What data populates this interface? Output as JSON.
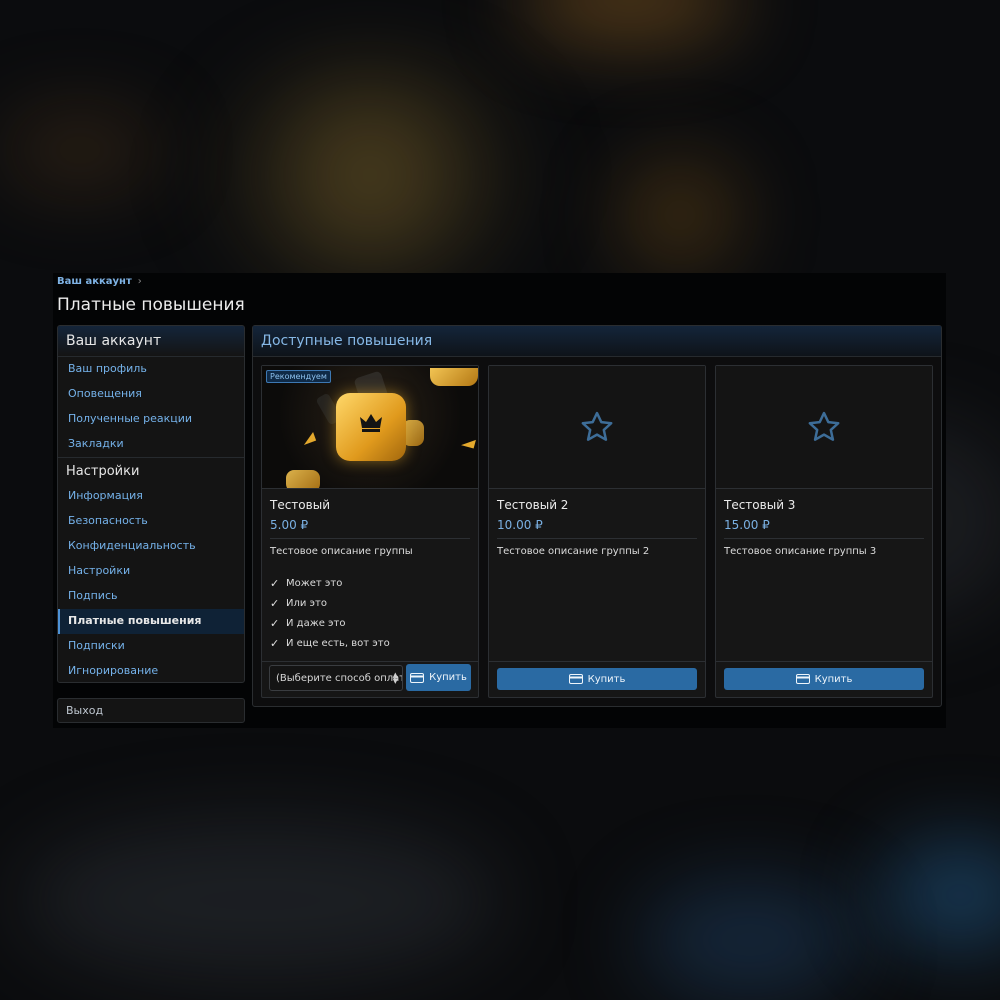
{
  "breadcrumb": {
    "label": "Ваш аккаунт"
  },
  "page": {
    "title": "Платные повышения"
  },
  "sidebar": {
    "account_header": "Ваш аккаунт",
    "account_items": [
      {
        "label": "Ваш профиль"
      },
      {
        "label": "Оповещения"
      },
      {
        "label": "Полученные реакции"
      },
      {
        "label": "Закладки"
      }
    ],
    "settings_header": "Настройки",
    "settings_items": [
      {
        "label": "Информация"
      },
      {
        "label": "Безопасность"
      },
      {
        "label": "Конфиденциальность"
      },
      {
        "label": "Настройки"
      },
      {
        "label": "Подпись"
      },
      {
        "label": "Платные повышения"
      },
      {
        "label": "Подписки"
      },
      {
        "label": "Игнорирование"
      }
    ],
    "active_item": "Платные повышения",
    "logout": "Выход"
  },
  "main": {
    "title": "Доступные повышения",
    "upgrades": [
      {
        "name": "Тестовый",
        "price": "5.00 ₽",
        "description": "Тестовое описание группы",
        "badge": "Рекомендуем",
        "features": [
          "Может это",
          "Или это",
          "И даже это",
          "И еще есть, вот это"
        ],
        "payment_placeholder": "(Выберите способ оплаты)",
        "buy_label": "Купить",
        "icon": "promo-image"
      },
      {
        "name": "Тестовый 2",
        "price": "10.00 ₽",
        "description": "Тестовое описание группы 2",
        "buy_label": "Купить",
        "icon": "star-icon"
      },
      {
        "name": "Тестовый 3",
        "price": "15.00 ₽",
        "description": "Тестовое описание группы 3",
        "buy_label": "Купить",
        "icon": "star-icon"
      }
    ]
  },
  "colors": {
    "accent": "#2a6aa3",
    "link": "#75b2ea",
    "background": "#030405",
    "panel": "#161616"
  }
}
